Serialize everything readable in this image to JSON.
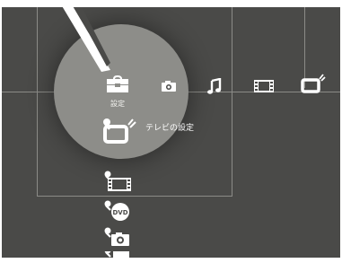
{
  "xmb": {
    "categories": [
      {
        "id": "settings",
        "icon": "toolbox-icon",
        "label": "設定"
      },
      {
        "id": "photo",
        "icon": "camera-icon"
      },
      {
        "id": "music",
        "icon": "music-note-icon"
      },
      {
        "id": "video",
        "icon": "film-strip-icon"
      },
      {
        "id": "tv",
        "icon": "tv-icon"
      }
    ],
    "selected_category": "settings",
    "sub_items": [
      {
        "icon": "tv-settings-icon",
        "label": "テレビの設定",
        "selected": true
      },
      {
        "icon": "video-settings-icon"
      },
      {
        "icon": "dvd-settings-icon",
        "badge_text": "DVD"
      },
      {
        "icon": "photo-settings-icon"
      },
      {
        "icon": "music-settings-icon"
      }
    ]
  },
  "colors": {
    "screen_bg": "#4a4a48",
    "highlight": "#8d8d89",
    "icon": "#ffffff",
    "text": "#ffffff"
  }
}
